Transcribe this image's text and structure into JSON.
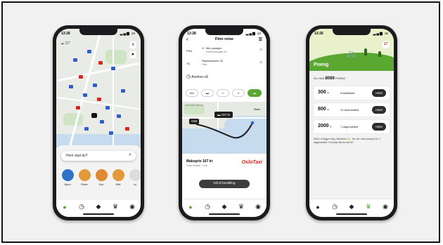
{
  "colors": {
    "brand_green": "#5aa832",
    "taxi_red": "#d7261e",
    "dark_button": "#2c2c2c"
  },
  "phone1": {
    "time": "13:26",
    "weather": "22°",
    "search_placeholder": "Hvor skal du?",
    "shortcuts": [
      {
        "label": "Hjem",
        "icon": "home-icon",
        "color": "#2f73c8"
      },
      {
        "label": "Ruter",
        "icon": "route-icon",
        "color": "#e19a3b"
      },
      {
        "label": "Kar",
        "icon": "pin-icon",
        "color": "#e08832"
      },
      {
        "label": "MW",
        "icon": "building-icon",
        "color": "#e19a3b"
      },
      {
        "label": "Le",
        "icon": "more-icon",
        "color": "#dddddd"
      }
    ]
  },
  "phone2": {
    "time": "13:28",
    "title": "Finn reise",
    "from_label": "FRA",
    "from_main": "Min posisjon",
    "from_sub": "Drammensgate 40",
    "to_label": "TIL",
    "to_main": "Filipstadveien 25",
    "to_sub": "Oslo",
    "depart": "Avreise nå",
    "filters": [
      "Alle",
      "bus-icon",
      "bike-icon",
      "walk-icon",
      "car-icon"
    ],
    "map_price": "167 kr",
    "map_end": "Slutt",
    "map_place1": "GRÜNERLØKKA",
    "map_place2": "Oslo",
    "price_title": "Makspris 167 kr",
    "price_sub": "Total reisetid 7 min",
    "taxi_brand": "OsloTaxi",
    "cta": "Gå til bestilling"
  },
  "phone3": {
    "time": "13:26",
    "badge": "17",
    "title": "Poeng",
    "points_prefix": "DU HAR",
    "points_value": "8089",
    "points_suffix": "POENG",
    "rewards": [
      {
        "points": "300",
        "unit": "p.",
        "name": "Enkeltbillett",
        "action": "Hent"
      },
      {
        "points": "800",
        "unit": "p.",
        "name": "24-timersbillett",
        "action": "Hent"
      },
      {
        "points": "2000",
        "unit": "p.",
        "name": "7-dagersbillett",
        "action": "Hent"
      }
    ],
    "note": "Kfisli, ni digger deg, Marianne 🙌. Du har nok poeng til en 7-dagersbillett. Hvordan får du det til?"
  },
  "tabbar_icons": [
    "home-icon",
    "clock-icon",
    "ticket-icon",
    "trophy-icon",
    "profile-icon"
  ]
}
